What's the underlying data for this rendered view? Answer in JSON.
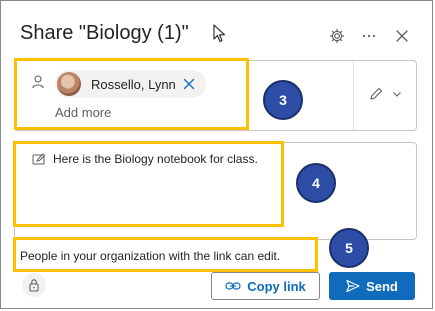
{
  "dialog": {
    "title": "Share \"Biology (1)\"",
    "icons": {
      "settings": "gear-icon",
      "more": "ellipsis-icon",
      "close": "close-icon"
    }
  },
  "recipients": {
    "chip_name": "Rossello, Lynn",
    "add_more_placeholder": "Add more",
    "permission_icon": "pencil-icon"
  },
  "message": {
    "text": "Here is the Biology notebook for class."
  },
  "link_settings": {
    "text": "People in your organization with the link can edit."
  },
  "footer": {
    "copy_link_label": "Copy link",
    "send_label": "Send"
  },
  "callouts": [
    "3",
    "4",
    "5"
  ],
  "colors": {
    "accent": "#0f6cbd",
    "highlight": "#ffc000",
    "callout": "#2e4da7"
  }
}
